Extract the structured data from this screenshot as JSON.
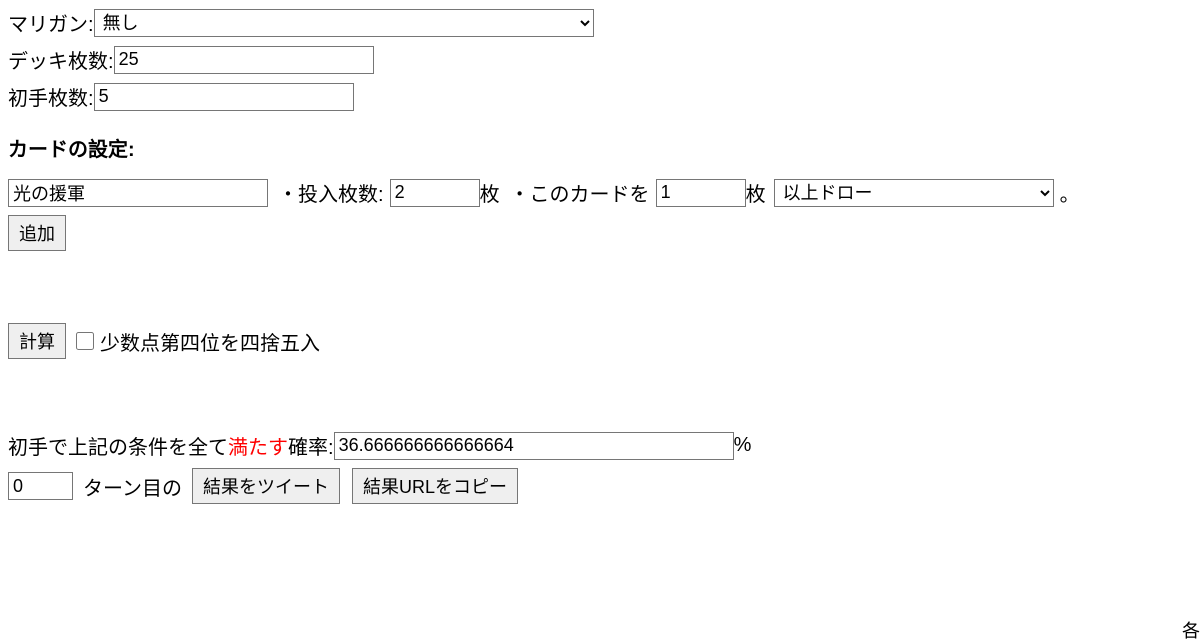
{
  "mulligan": {
    "label": "マリガン:",
    "value": "無し"
  },
  "deck": {
    "label": "デッキ枚数:",
    "value": "25"
  },
  "hand": {
    "label": "初手枚数:",
    "value": "5"
  },
  "card_settings_heading": "カードの設定:",
  "card": {
    "name_value": "光の援軍",
    "count_label_prefix": "・投入枚数:",
    "count_value": "2",
    "count_label_suffix": "枚",
    "draw_label_prefix": "・このカードを",
    "draw_value": "1",
    "draw_label_suffix": "枚",
    "condition_value": "以上ドロー",
    "period": "。"
  },
  "add_button": "追加",
  "calc_button": "計算",
  "round_checkbox_label": "少数点第四位を四捨五入",
  "result": {
    "prefix1": "初手で上記の条件を全て",
    "highlight": "満たす",
    "prefix2": "確率:",
    "value": "36.666666666666664",
    "suffix": "%"
  },
  "turn": {
    "value": "0",
    "label": "ターン目の",
    "tweet_button": "結果をツイート",
    "copy_button": "結果URLをコピー"
  },
  "corner_text": "各"
}
